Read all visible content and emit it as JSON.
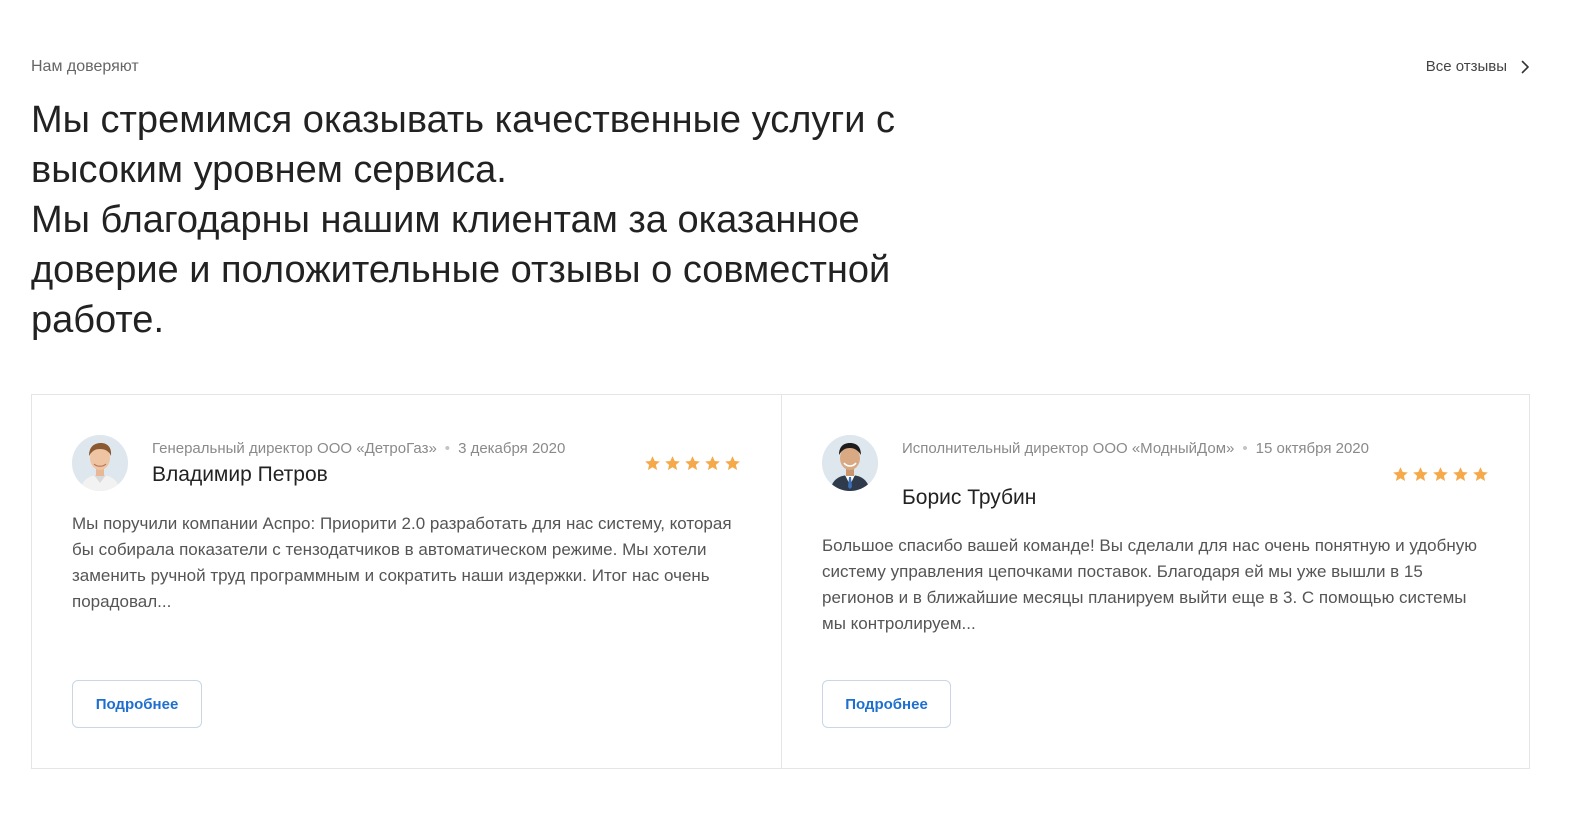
{
  "header": {
    "eyebrow": "Нам доверяют",
    "all_reviews_label": "Все отзывы",
    "headline_lines": [
      "Мы стремимся оказывать качественные услуги с",
      "высоким уровнем сервиса.",
      "Мы благодарны нашим клиентам за оказанное",
      "доверие и положительные отзывы о совместной",
      "работе."
    ]
  },
  "reviews": [
    {
      "position": "Генеральный директор ООО «ДетроГаз»",
      "separator": "•",
      "date": "3 декабря 2020",
      "name": "Владимир Петров",
      "rating": 5,
      "text": "Мы поручили компании Аспро: Приорити 2.0 разработать для нас систему, которая бы собирала показатели с тензодатчиков в автоматическом режиме. Мы хотели заменить ручной труд программным и сократить наши издержки. Итог нас очень порадовал...",
      "button_label": "Подробнее"
    },
    {
      "position": "Исполнительный директор ООО «МодныйДом»",
      "separator": "•",
      "date": "15 октября 2020",
      "name": "Борис Трубин",
      "rating": 5,
      "text": "Большое спасибо вашей команде! Вы сделали для нас очень понятную и удобную систему управления цепочками поставок. Благодаря ей мы уже вышли в 15 регионов и в ближайшие месяцы планируем выйти еще в 3. С помощью системы мы контролируем...",
      "button_label": "Подробнее"
    }
  ],
  "colors": {
    "accent": "#1f6fcf",
    "star": "#f5a94a",
    "border": "#e5e5e5"
  },
  "icons": {
    "all_reviews": "chevron-right-icon",
    "rating": "star-icon"
  }
}
